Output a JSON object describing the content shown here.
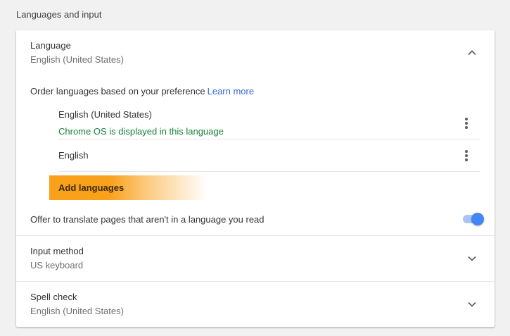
{
  "section_title": "Languages and input",
  "language": {
    "title": "Language",
    "value": "English (United States)",
    "order_label": "Order languages based on your preference",
    "learn_more": "Learn more",
    "items": [
      {
        "name": "English (United States)",
        "note": "Chrome OS is displayed in this language"
      },
      {
        "name": "English"
      }
    ],
    "add_languages": "Add languages",
    "translate_offer": "Offer to translate pages that aren't in a language you read",
    "translate_enabled": true
  },
  "input_method": {
    "title": "Input method",
    "value": "US keyboard"
  },
  "spell_check": {
    "title": "Spell check",
    "value": "English (United States)"
  },
  "icons": {
    "collapse": "chevron-up-icon",
    "expand": "chevron-down-icon",
    "more": "more-vert-icon"
  },
  "colors": {
    "accent": "#4285f4",
    "link": "#3367d6",
    "note": "#188038",
    "highlight": "#f9a11b"
  }
}
